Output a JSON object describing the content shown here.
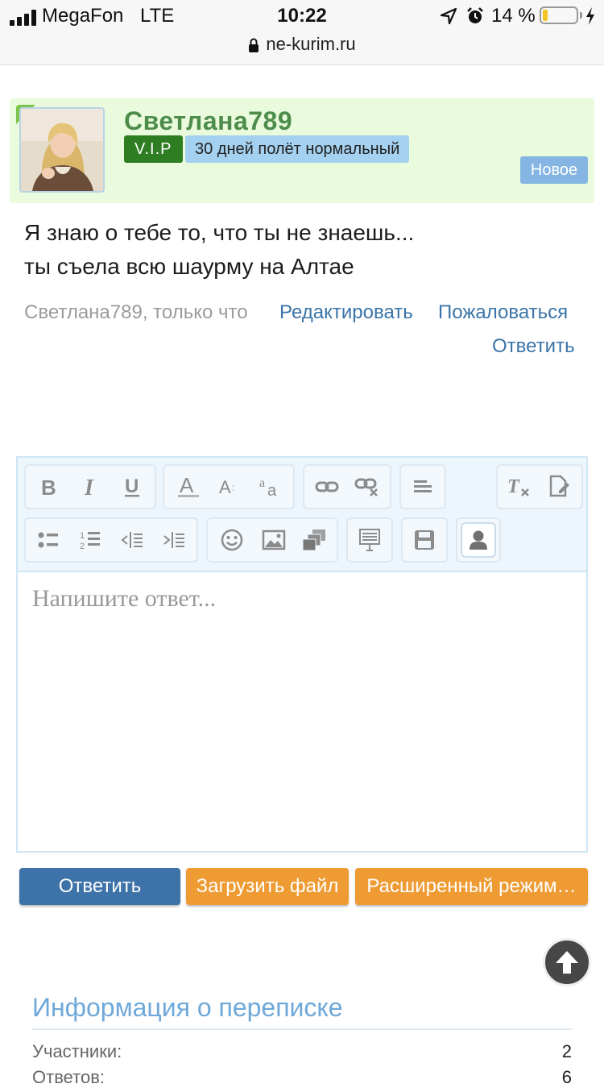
{
  "status_bar": {
    "carrier": "MegaFon",
    "network": "LTE",
    "time": "10:22",
    "battery_percent": "14 %",
    "battery_level": 0.14,
    "url": "ne-kurim.ru"
  },
  "message": {
    "username": "Светлана789",
    "vip_badge": "V.I.P",
    "user_title": "30 дней полёт нормальный",
    "new_badge": "Новое",
    "text": "Я знаю о тебе то, что ты не знаешь...\nты съела всю шаурму на Алтае",
    "meta_author": "Светлана789, только что",
    "edit_link": "Редактировать",
    "report_link": "Пожаловаться",
    "reply_link": "Ответить"
  },
  "editor": {
    "placeholder": "Напишите ответ..."
  },
  "actions": {
    "reply": "Ответить",
    "upload": "Загрузить файл",
    "advanced": "Расширенный режим…"
  },
  "info": {
    "title": "Информация о переписке",
    "rows": [
      {
        "label": "Участники:",
        "value": "2"
      },
      {
        "label": "Ответов:",
        "value": "6"
      }
    ]
  },
  "colors": {
    "accent_link": "#3a74a8",
    "vip_green": "#2f7d22",
    "orange": "#ef9b34"
  }
}
